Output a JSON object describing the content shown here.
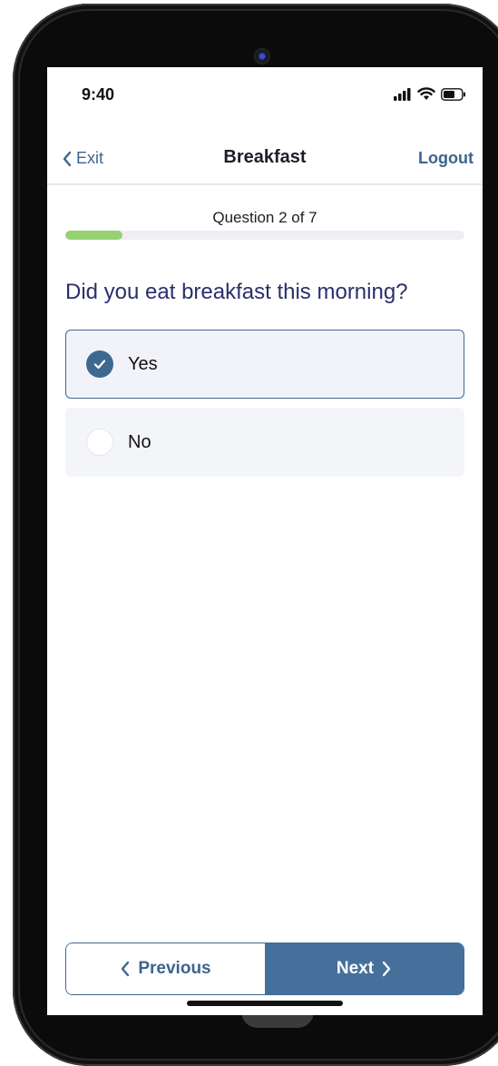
{
  "status_bar": {
    "time": "9:40",
    "icons": [
      "signal-icon",
      "wifi-icon",
      "battery-icon"
    ]
  },
  "nav": {
    "back_label": "Exit",
    "title": "Breakfast",
    "logout_label": "Logout"
  },
  "progress": {
    "label": "Question 2 of 7",
    "fraction": 0.143
  },
  "question": {
    "text": "Did you eat breakfast this morning?",
    "options": [
      {
        "label": "Yes",
        "selected": true
      },
      {
        "label": "No",
        "selected": false
      }
    ]
  },
  "footer": {
    "previous_label": "Previous",
    "next_label": "Next"
  },
  "colors": {
    "accent": "#3f6891",
    "progress_fill": "#96d274",
    "question_text": "#2b2f6b"
  }
}
